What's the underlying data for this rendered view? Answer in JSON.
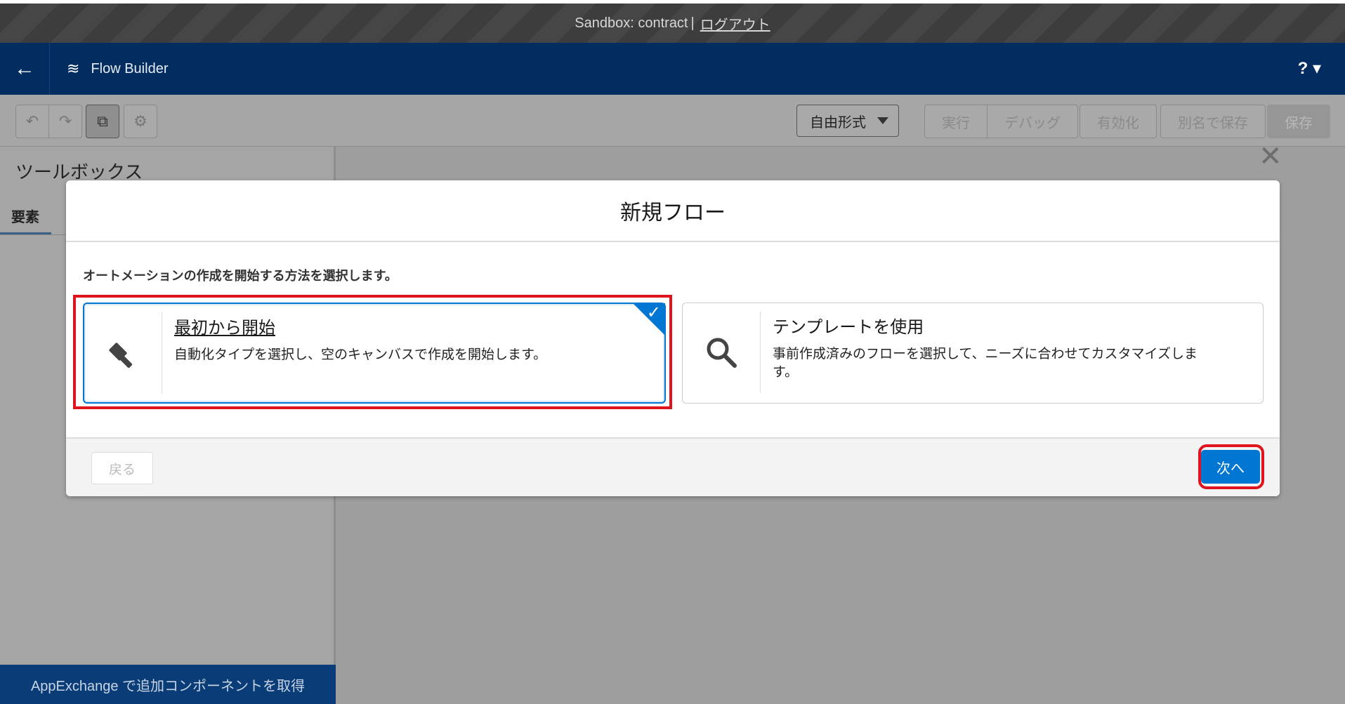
{
  "sandbox": {
    "text": "Sandbox: contract",
    "separator": "|",
    "logout": "ログアウト"
  },
  "header": {
    "title": "Flow Builder",
    "help": "? ▾"
  },
  "toolbar": {
    "layout_mode": "自由形式",
    "run": "実行",
    "debug": "デバッグ",
    "activate": "有効化",
    "save_as": "別名で保存",
    "save": "保存"
  },
  "left_panel": {
    "title": "ツールボックス",
    "tab_elements": "要素",
    "appexchange": "AppExchange で追加コンポーネントを取得"
  },
  "modal": {
    "title": "新規フロー",
    "instruction": "オートメーションの作成を開始する方法を選択します。",
    "options": [
      {
        "title": "最初から開始",
        "description": "自動化タイプを選択し、空のキャンバスで作成を開始します。",
        "icon": "hammer-icon",
        "selected": true
      },
      {
        "title": "テンプレートを使用",
        "description": "事前作成済みのフローを選択して、ニーズに合わせてカスタマイズします。",
        "icon": "search-icon",
        "selected": false
      }
    ],
    "back": "戻る",
    "next": "次へ"
  },
  "colors": {
    "brand_blue": "#0176d3",
    "header_navy": "#032d60",
    "highlight_red": "#e0141e"
  }
}
